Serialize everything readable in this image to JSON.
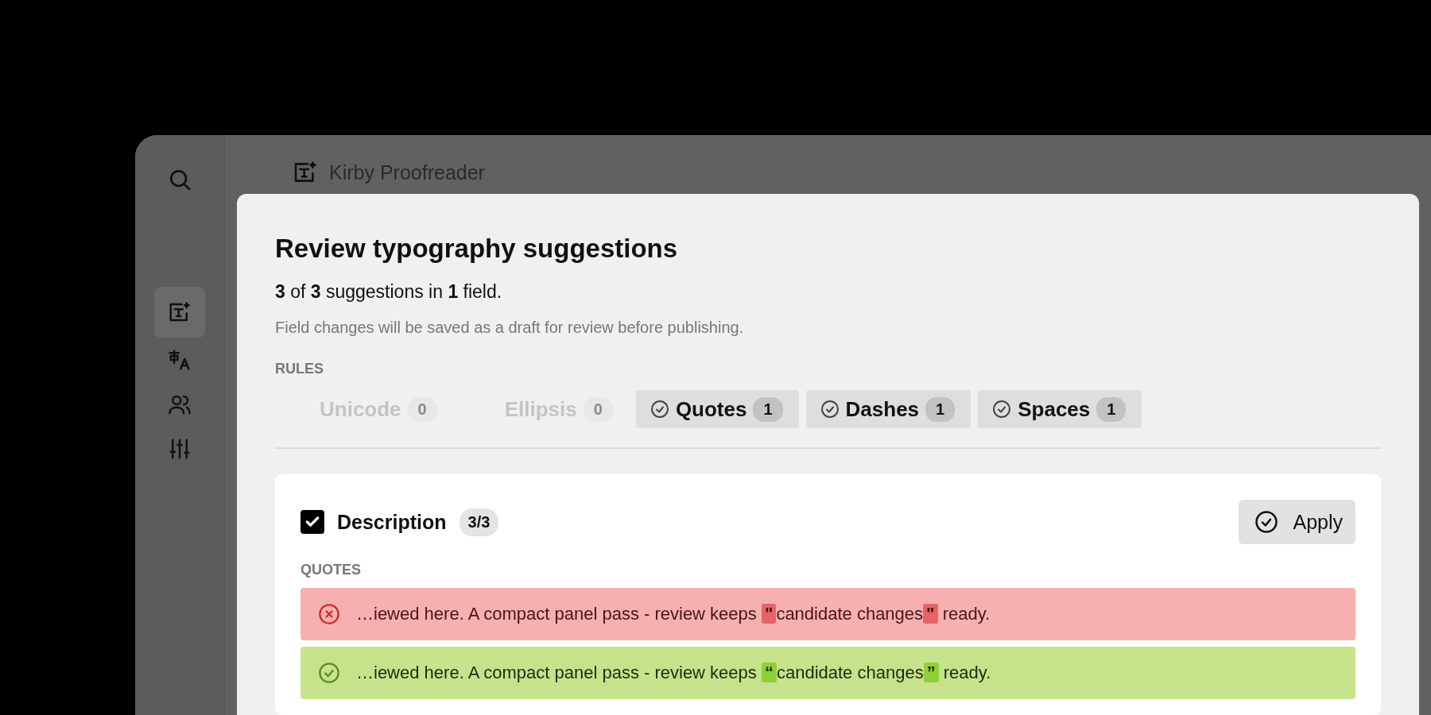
{
  "app": {
    "title": "Kirby Proofreader"
  },
  "sidebar": {
    "items": [
      {
        "selected": false
      },
      {
        "selected": true
      },
      {
        "selected": false
      },
      {
        "selected": false
      },
      {
        "selected": false
      }
    ]
  },
  "dialog": {
    "title": "Review typography suggestions",
    "summary": "**3** of **3** suggestions in **1** field.",
    "hint": "Field changes will be saved as a draft for review before publishing.",
    "rules_label": "RULES",
    "rules": [
      {
        "label": "Unicode",
        "count": "0",
        "enabled": false
      },
      {
        "label": "Ellipsis",
        "count": "0",
        "enabled": false
      },
      {
        "label": "Quotes",
        "count": "1",
        "enabled": true
      },
      {
        "label": "Dashes",
        "count": "1",
        "enabled": true
      },
      {
        "label": "Spaces",
        "count": "1",
        "enabled": true
      }
    ],
    "field": {
      "name": "Description",
      "checked": true,
      "count": "3/3",
      "apply_label": "Apply",
      "group_label": "QUOTES",
      "rows": [
        {
          "kind": "original",
          "parts": [
            {
              "text": "…iewed here. A compact panel pass - review keeps ",
              "mark": false
            },
            {
              "text": "\"",
              "mark": true
            },
            {
              "text": "candidate changes",
              "mark": false
            },
            {
              "text": "\"",
              "mark": true
            },
            {
              "text": " ready.",
              "mark": false
            }
          ]
        },
        {
          "kind": "fixed",
          "parts": [
            {
              "text": "…iewed here. A compact panel pass - review keeps ",
              "mark": false
            },
            {
              "text": "“",
              "mark": true
            },
            {
              "text": "candidate changes",
              "mark": false
            },
            {
              "text": "”",
              "mark": true
            },
            {
              "text": " ready.",
              "mark": false
            }
          ]
        }
      ]
    }
  }
}
